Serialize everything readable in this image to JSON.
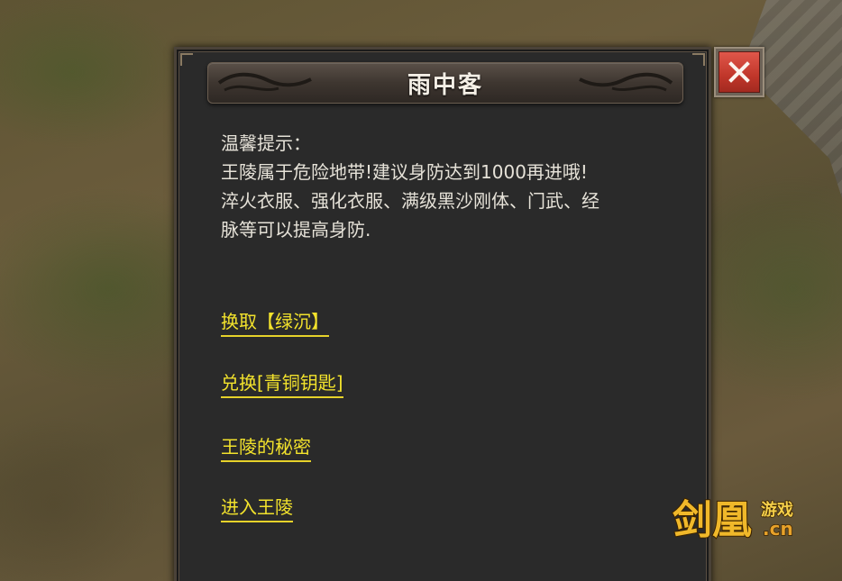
{
  "dialog": {
    "title": "雨中客",
    "message_lines": [
      "温馨提示：",
      "王陵属于危险地带!建议身防达到1000再进哦!",
      "淬火衣服、强化衣服、满级黑沙刚体、门武、经",
      "脉等可以提高身防."
    ],
    "options": [
      {
        "label": "换取【绿沉】"
      },
      {
        "label": "兑换[青铜钥匙]"
      },
      {
        "label": "王陵的秘密"
      },
      {
        "label": "进入王陵"
      }
    ]
  },
  "colors": {
    "link": "#f2e22c",
    "text": "#e6e2d8",
    "panel": "#2a2a2a",
    "close": "#d04436"
  },
  "icons": {
    "close": "close-x-icon"
  },
  "watermark": {
    "main": "剑凰",
    "sub": "游戏",
    "domain": ".cn"
  }
}
